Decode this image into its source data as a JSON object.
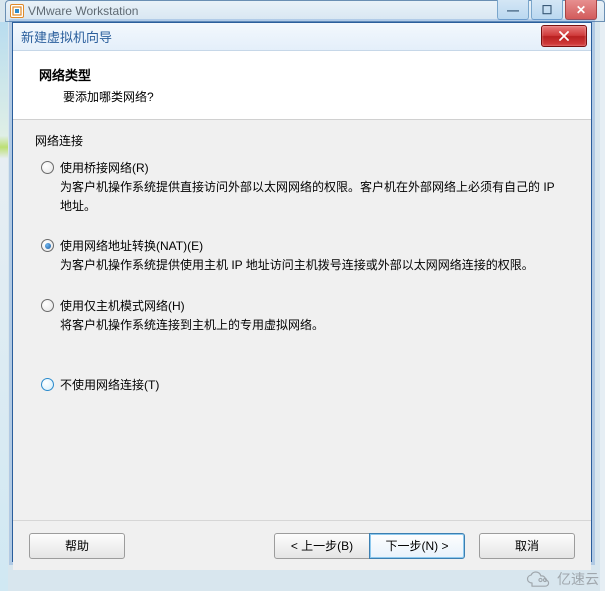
{
  "parent_window": {
    "title": "VMware Workstation",
    "controls": {
      "min": "—",
      "max": "☐",
      "close": "✕"
    }
  },
  "wizard": {
    "title": "新建虚拟机向导",
    "close_label": "✕",
    "header": {
      "title": "网络类型",
      "subtitle": "要添加哪类网络?"
    },
    "group_label": "网络连接",
    "options": [
      {
        "label": "使用桥接网络(R)",
        "desc": "为客户机操作系统提供直接访问外部以太网网络的权限。客户机在外部网络上必须有自己的 IP 地址。",
        "selected": false
      },
      {
        "label": "使用网络地址转换(NAT)(E)",
        "desc": "为客户机操作系统提供使用主机 IP 地址访问主机拨号连接或外部以太网网络连接的权限。",
        "selected": true
      },
      {
        "label": "使用仅主机模式网络(H)",
        "desc": "将客户机操作系统连接到主机上的专用虚拟网络。",
        "selected": false
      },
      {
        "label": "不使用网络连接(T)",
        "desc": "",
        "selected": false,
        "blue": true
      }
    ],
    "buttons": {
      "help": "帮助",
      "back": "< 上一步(B)",
      "next": "下一步(N) >",
      "cancel": "取消"
    }
  },
  "watermark": "亿速云"
}
